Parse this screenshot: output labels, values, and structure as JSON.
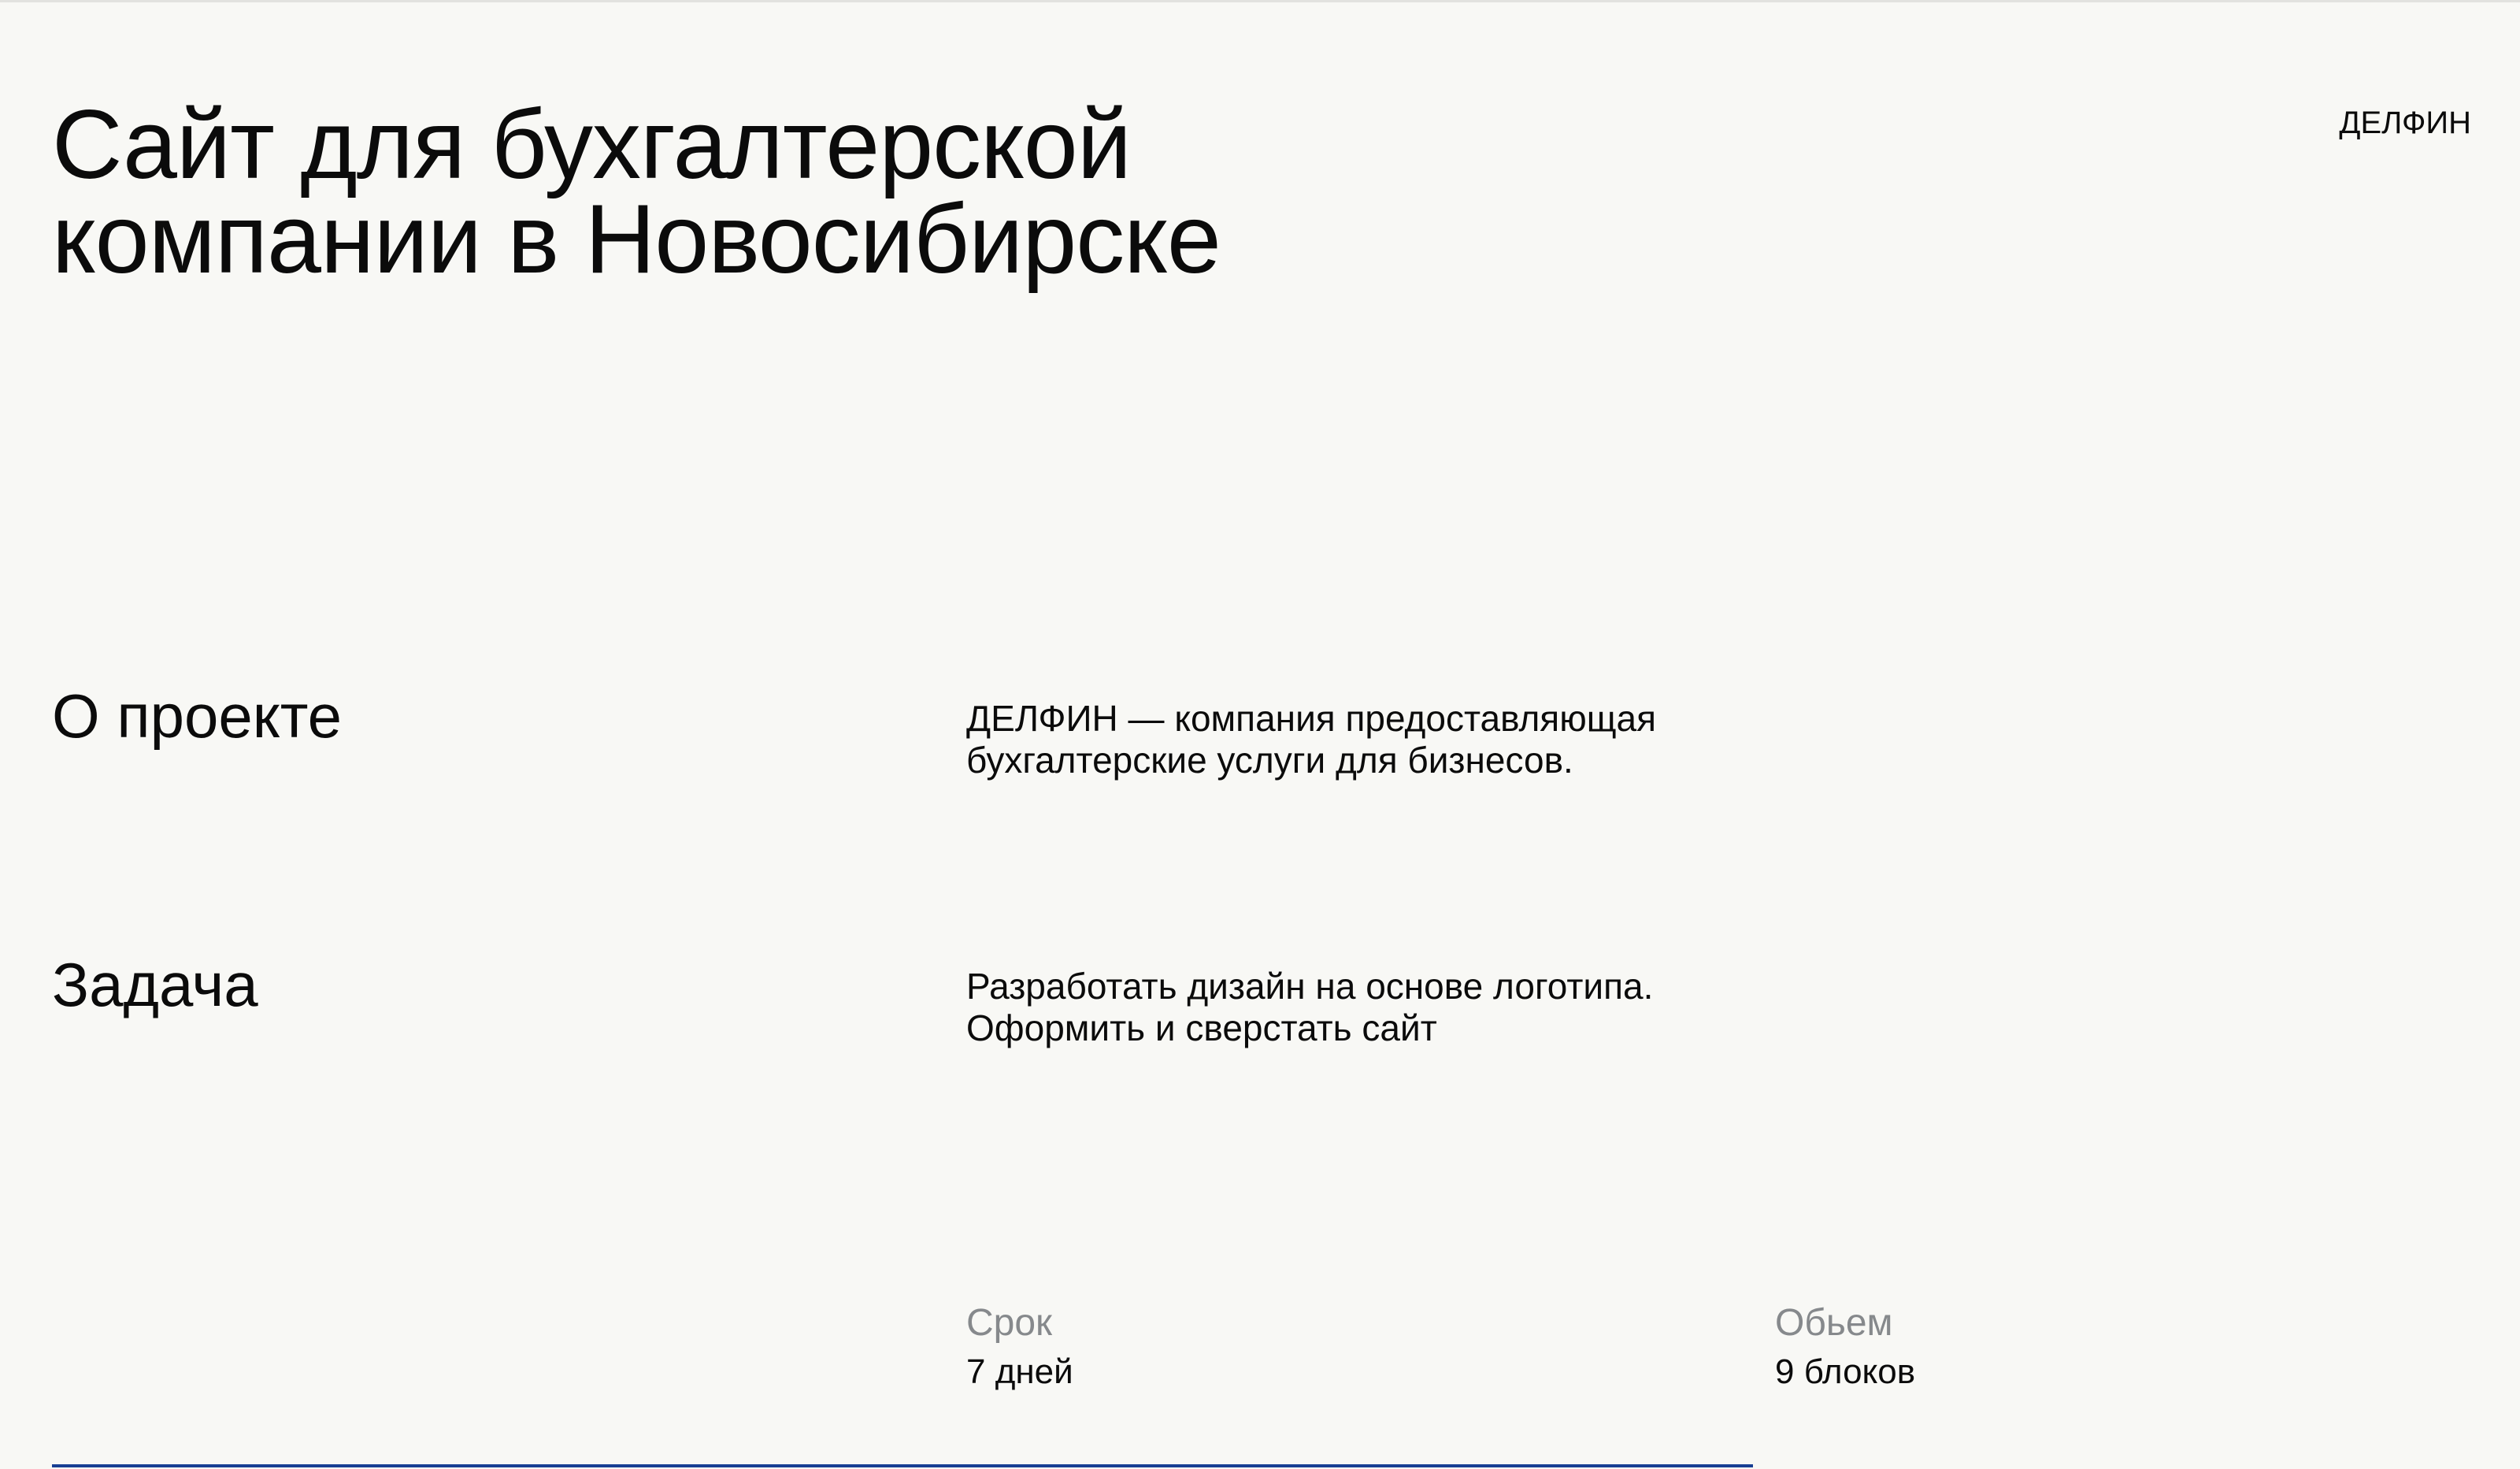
{
  "header": {
    "title": "Сайт для бухгалтерской компании в Новосибирске",
    "brand": "ДЕЛФИН"
  },
  "sections": [
    {
      "heading": "О проекте",
      "text": "ДЕЛФИН  — компания предоставляющая\nбухгалтерские услуги для бизнесов."
    },
    {
      "heading": "Задача",
      "text": "Разработать дизайн на основе логотипа.\nОформить и сверстать сайт"
    }
  ],
  "metrics": {
    "term": {
      "label": "Срок",
      "value": "7 дней"
    },
    "volume": {
      "label": "Обьем",
      "value": "9 блоков"
    }
  },
  "colors": {
    "background": "#f8f8f5",
    "text": "#0b0b0b",
    "muted": "#86898c",
    "accent": "#183f93"
  }
}
